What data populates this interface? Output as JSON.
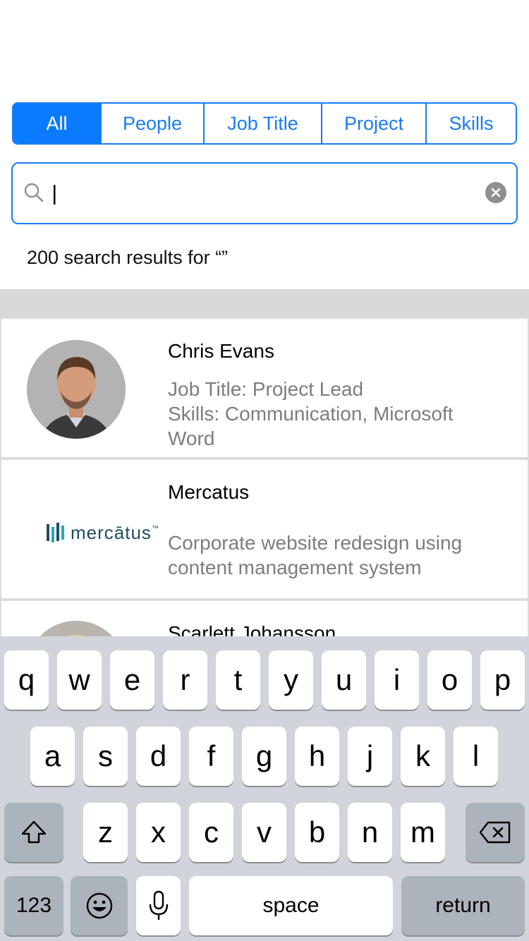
{
  "filters": {
    "tabs": [
      {
        "label": "All"
      },
      {
        "label": "People"
      },
      {
        "label": "Job Title"
      },
      {
        "label": "Project"
      },
      {
        "label": "Skills"
      }
    ],
    "active_index": 0
  },
  "search": {
    "value": "",
    "icon": "magnifying-glass-icon",
    "clear_icon": "clear-icon"
  },
  "results_count_text": "200 search results for “”",
  "results": [
    {
      "name": "Chris Evans",
      "details": "Job Title: Project Lead\nSkills: Communication, Microsoft Word",
      "line1": "Job Title: Project Lead",
      "line2": "Skills: Communication, Microsoft Word"
    },
    {
      "name": "Mercatus",
      "logo_text": "mercātus",
      "logo_tm": "™",
      "description": "Corporate website redesign using content management system"
    },
    {
      "name": "Scarlett Johansson"
    }
  ],
  "keyboard": {
    "row1": [
      "q",
      "w",
      "e",
      "r",
      "t",
      "y",
      "u",
      "i",
      "o",
      "p"
    ],
    "row2": [
      "a",
      "s",
      "d",
      "f",
      "g",
      "h",
      "j",
      "k",
      "l"
    ],
    "row3": [
      "z",
      "x",
      "c",
      "v",
      "b",
      "n",
      "m"
    ],
    "numbers_label": "123",
    "space_label": "space",
    "return_label": "return",
    "shift_icon": "shift-icon",
    "delete_icon": "delete-icon",
    "emoji_icon": "emoji-icon",
    "mic_icon": "microphone-icon"
  },
  "colors": {
    "accent": "#1a7cf0",
    "active_tab": "#0a7bff",
    "secondary_text": "#7d7d7d",
    "keyboard_bg": "#d1d5db"
  }
}
